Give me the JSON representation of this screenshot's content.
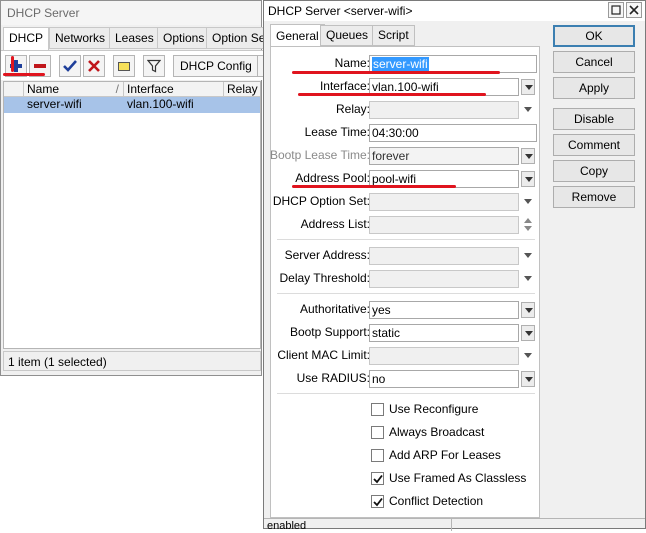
{
  "background_window": {
    "title": "DHCP Server",
    "tabs": [
      "DHCP",
      "Networks",
      "Leases",
      "Options",
      "Option Set"
    ],
    "toolbar": {
      "add_icon": "plus-icon",
      "remove_icon": "minus-icon",
      "enable_icon": "check-icon",
      "disable_icon": "x-icon",
      "comment_icon": "note-icon",
      "filter_icon": "filter-icon",
      "dhcp_config_label": "DHCP Config"
    },
    "table": {
      "columns": [
        "Name",
        "Interface",
        "Relay"
      ],
      "sort_marker": "/",
      "rows": [
        {
          "name": "server-wifi",
          "interface": "vlan.100-wifi",
          "relay": ""
        }
      ]
    },
    "status": "1 item (1 selected)"
  },
  "dialog": {
    "title": "DHCP Server <server-wifi>",
    "tabs": [
      "General",
      "Queues",
      "Script"
    ],
    "fields": {
      "name": {
        "label": "Name:",
        "value": "server-wifi"
      },
      "interface": {
        "label": "Interface:",
        "value": "vlan.100-wifi"
      },
      "relay": {
        "label": "Relay:",
        "value": ""
      },
      "lease_time": {
        "label": "Lease Time:",
        "value": "04:30:00"
      },
      "bootp_lease_time": {
        "label": "Bootp Lease Time:",
        "value": "forever"
      },
      "address_pool": {
        "label": "Address Pool:",
        "value": "pool-wifi"
      },
      "dhcp_option_set": {
        "label": "DHCP Option Set:",
        "value": ""
      },
      "address_list": {
        "label": "Address List:",
        "value": ""
      },
      "server_address": {
        "label": "Server Address:",
        "value": ""
      },
      "delay_threshold": {
        "label": "Delay Threshold:",
        "value": ""
      },
      "authoritative": {
        "label": "Authoritative:",
        "value": "yes"
      },
      "bootp_support": {
        "label": "Bootp Support:",
        "value": "static"
      },
      "client_mac_limit": {
        "label": "Client MAC Limit:",
        "value": ""
      },
      "use_radius": {
        "label": "Use RADIUS:",
        "value": "no"
      }
    },
    "checkboxes": [
      {
        "label": "Use Reconfigure",
        "checked": false
      },
      {
        "label": "Always Broadcast",
        "checked": false
      },
      {
        "label": "Add ARP For Leases",
        "checked": false
      },
      {
        "label": "Use Framed As Classless",
        "checked": true
      },
      {
        "label": "Conflict Detection",
        "checked": true
      }
    ],
    "buttons": {
      "ok": "OK",
      "cancel": "Cancel",
      "apply": "Apply",
      "disable": "Disable",
      "comment": "Comment",
      "copy": "Copy",
      "remove": "Remove"
    },
    "status": "enabled"
  },
  "colors": {
    "selection": "#a7c3e8",
    "text_selection": "#3399ff",
    "annotation_red": "#e0141e",
    "add_icon": "#1f3f9a",
    "remove_icon": "#c0161b"
  }
}
